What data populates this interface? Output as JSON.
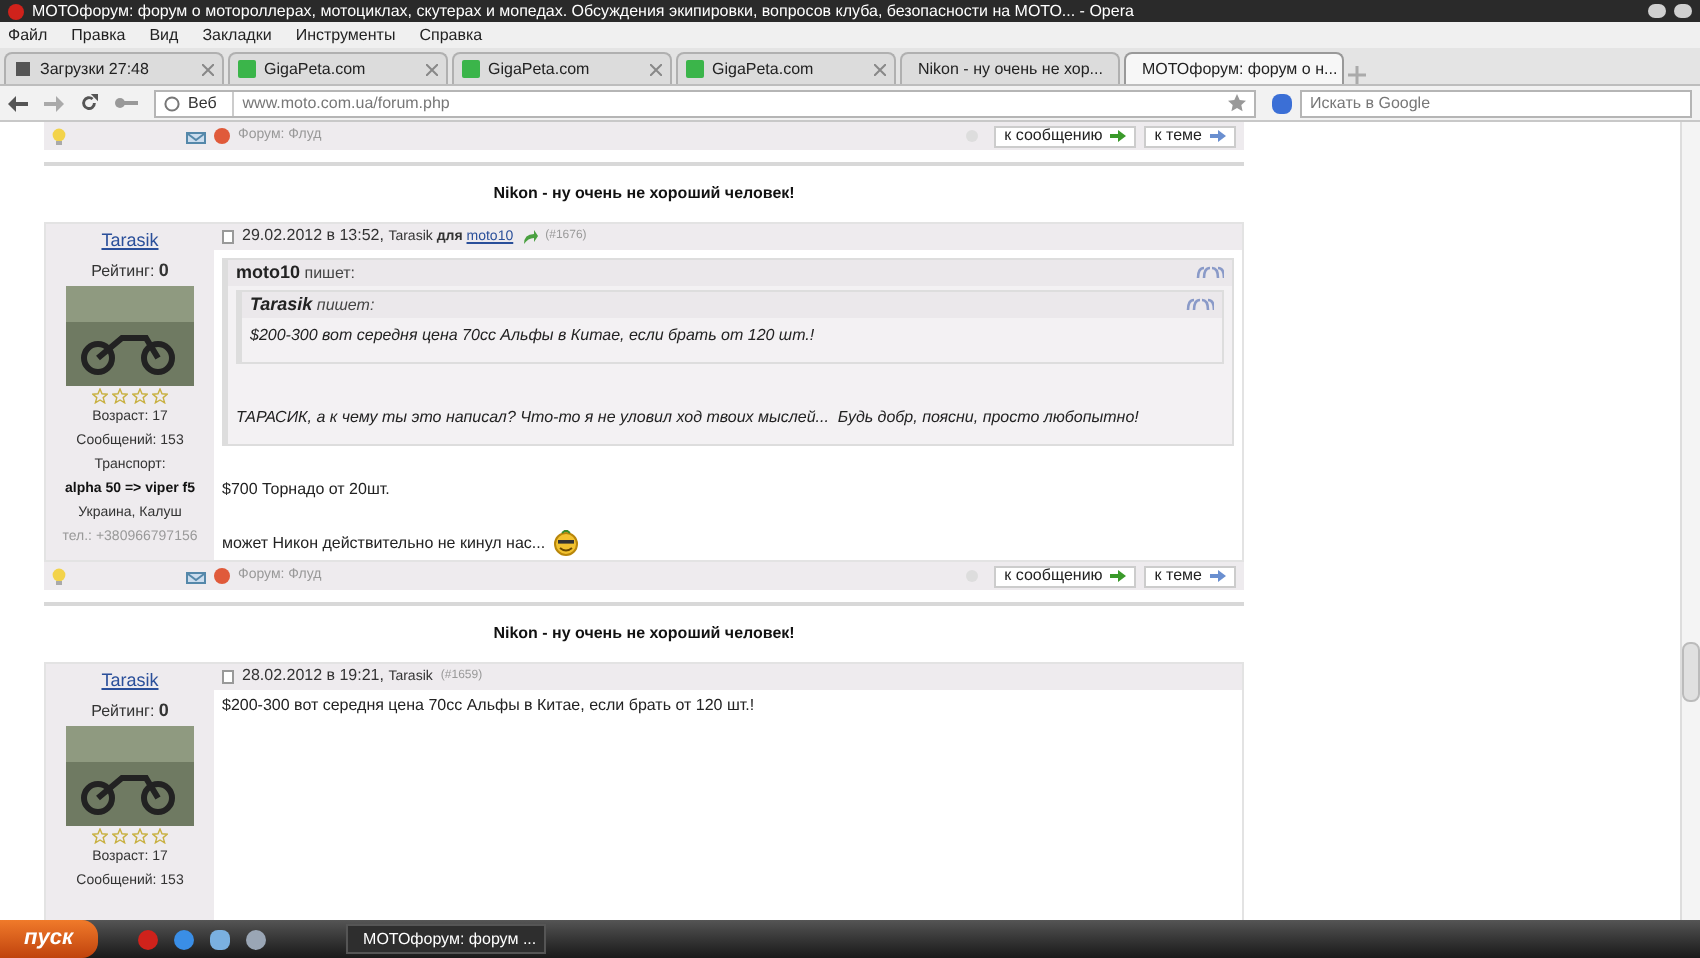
{
  "window": {
    "title": "МОТОфорум: форум о мотороллерах, мотоциклах, скутерах и мопедах. Обсуждения экипировки, вопросов клуба, безопасности на МОТО... - Opera"
  },
  "menu": [
    "Файл",
    "Правка",
    "Вид",
    "Закладки",
    "Инструменты",
    "Справка"
  ],
  "tabs": [
    {
      "label": "Загрузки 27:48",
      "kind": "downloads",
      "selected": false
    },
    {
      "label": "GigaPeta.com",
      "kind": "site",
      "selected": false
    },
    {
      "label": "GigaPeta.com",
      "kind": "site",
      "selected": false
    },
    {
      "label": "GigaPeta.com",
      "kind": "site",
      "selected": false
    },
    {
      "label": "Nikon - ну очень не хор...",
      "kind": "forum",
      "selected": false
    },
    {
      "label": "МОТОфорум: форум о н...",
      "kind": "forum",
      "selected": true
    }
  ],
  "address_bar": {
    "badge": "Веб",
    "url": "www.moto.com.ua/forum.php",
    "search_placeholder": "Искать в Google"
  },
  "top_footer": {
    "forum": "Форум: Флуд",
    "buttons": [
      "к сообщению",
      "к теме"
    ]
  },
  "posts": [
    {
      "title": "Nikon - ну очень не хороший человек!",
      "author": "Tarasik",
      "rating_label": "Рейтинг:",
      "rating": "0",
      "stars": 0,
      "info": [
        {
          "text": "Возраст: 17",
          "kind": "normal"
        },
        {
          "text": "Сообщений: 153",
          "kind": "normal"
        },
        {
          "text": "Транспорт:",
          "kind": "normal"
        },
        {
          "text": "alpha 50 => viper f5",
          "kind": "bold"
        },
        {
          "text": "Украина, Калуш",
          "kind": "normal"
        },
        {
          "text": "тел.: +380966797156",
          "kind": "muted"
        }
      ],
      "header": {
        "date": "29.02.2012 в 13:52,",
        "author": "Tarasik",
        "to_label": "для",
        "recipient": "moto10",
        "number": "(#1676)"
      },
      "blocks": [
        {
          "kind": "quote",
          "author": "moto10",
          "says": "пишет:",
          "blocks": [
            {
              "kind": "quote",
              "author": "Tarasik",
              "says": "пишет:",
              "blocks": [
                {
                  "kind": "text",
                  "text": "$200-300 вот середня цена 70сс Альфы в Китае, если брать от 120 шт.!"
                }
              ]
            },
            {
              "kind": "text",
              "text": "ТАРАСИК, а к чему ты это написал? Что-то я не уловил ход твоих мыслей...  Будь добр, поясни, просто любопытно!"
            }
          ]
        },
        {
          "kind": "text",
          "text": "$700 Торнадо от 20шт."
        },
        {
          "kind": "text",
          "text": "может Никон действительно не кинул нас...",
          "emoticon": true
        }
      ],
      "footer": {
        "forum": "Форум: Флуд",
        "buttons": [
          "к сообщению",
          "к теме"
        ]
      }
    },
    {
      "title": "Nikon - ну очень не хороший человек!",
      "author": "Tarasik",
      "rating_label": "Рейтинг:",
      "rating": "0",
      "stars": 0,
      "info": [
        {
          "text": "Возраст: 17",
          "kind": "normal"
        },
        {
          "text": "Сообщений: 153",
          "kind": "normal"
        }
      ],
      "header": {
        "date": "28.02.2012 в 19:21,",
        "author": "Tarasik",
        "number": "(#1659)"
      },
      "blocks": [
        {
          "kind": "text",
          "text": "$200-300 вот середня цена 70сс Альфы в Китае, если брать от 120 шт.!"
        }
      ]
    }
  ],
  "taskbar": {
    "start": "пуск",
    "windows": [
      "МОТОфорум: форум ..."
    ]
  }
}
